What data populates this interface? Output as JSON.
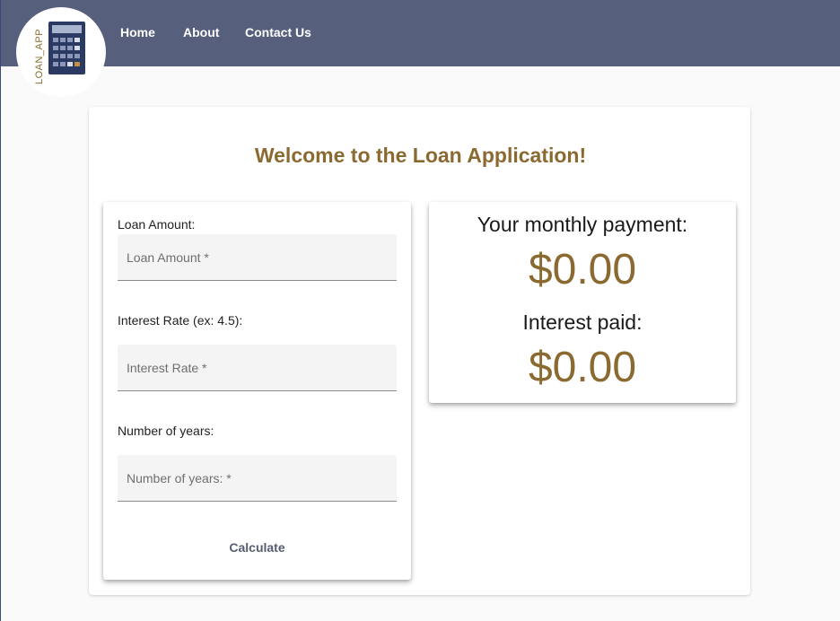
{
  "logo": {
    "text": "LOAN_APP",
    "icon": "calculator-icon"
  },
  "nav": {
    "home": "Home",
    "about": "About",
    "contact": "Contact Us"
  },
  "page": {
    "title": "Welcome to the Loan Application!"
  },
  "form": {
    "loan_amount": {
      "label": "Loan Amount:",
      "placeholder": "Loan Amount *",
      "value": ""
    },
    "interest_rate": {
      "label": "Interest Rate (ex: 4.5):",
      "placeholder": "Interest Rate *",
      "value": ""
    },
    "years": {
      "label": "Number of years:",
      "placeholder": "Number of years: *",
      "value": ""
    },
    "calculate_label": "Calculate"
  },
  "results": {
    "monthly_label": "Your monthly payment:",
    "monthly_value": "$0.00",
    "interest_label": "Interest paid:",
    "interest_value": "$0.00"
  },
  "colors": {
    "topbar": "#56607c",
    "accent": "#8b6a32",
    "background": "#fafafa"
  }
}
